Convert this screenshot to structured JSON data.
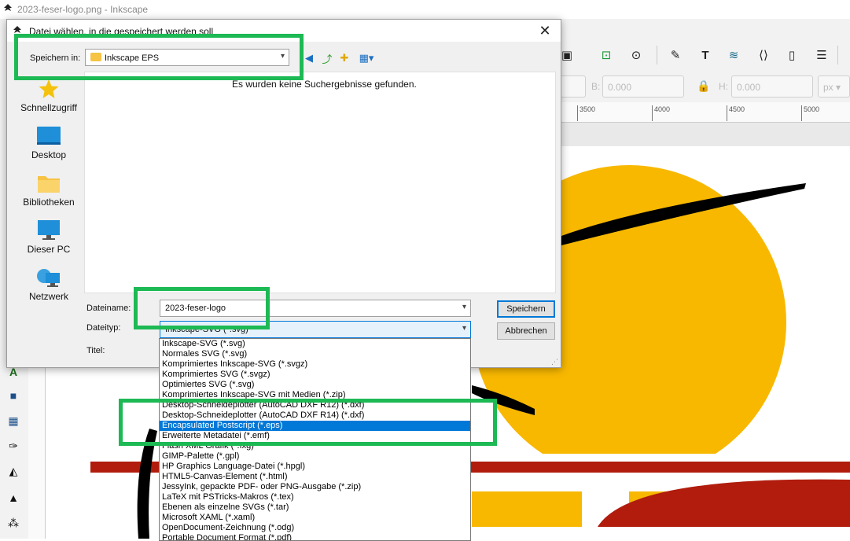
{
  "inkscape": {
    "window_title": "2023-feser-logo.png - Inkscape",
    "coords": {
      "b_label": "B:",
      "b_value": "0.000",
      "h_label": "H:",
      "h_value": "0.000",
      "unit": "px"
    },
    "ruler_ticks": [
      "3500",
      "4000",
      "4500",
      "5000"
    ],
    "colors": {
      "sun": "#f8b800",
      "stripe": "#b11c0c"
    }
  },
  "dialog": {
    "title": "Datei wählen, in die gespeichert werden soll",
    "save_in_label": "Speichern in:",
    "save_in_value": "Inkscape EPS",
    "empty_message": "Es wurden keine Suchergebnisse gefunden.",
    "places": [
      {
        "label": "Schnellzugriff",
        "icon": "star-icon"
      },
      {
        "label": "Desktop",
        "icon": "desktop-icon"
      },
      {
        "label": "Bibliotheken",
        "icon": "library-folder-icon"
      },
      {
        "label": "Dieser PC",
        "icon": "computer-icon"
      },
      {
        "label": "Netzwerk",
        "icon": "network-icon"
      }
    ],
    "filename_label": "Dateiname:",
    "filename_value": "2023-feser-logo",
    "filetype_label": "Dateityp:",
    "filetype_value": "Inkscape-SVG (*.svg)",
    "title_label": "Titel:",
    "save_button": "Speichern",
    "cancel_button": "Abbrechen",
    "filetype_options": [
      "Inkscape-SVG (*.svg)",
      "Normales SVG (*.svg)",
      "Komprimiertes Inkscape-SVG (*.svgz)",
      "Komprimiertes SVG (*.svgz)",
      "Optimiertes SVG (*.svg)",
      "Komprimiertes Inkscape-SVG mit Medien (*.zip)",
      "Desktop-Schneideplotter (AutoCAD DXF R12) (*.dxf)",
      "Desktop-Schneideplotter (AutoCAD DXF R14) (*.dxf)",
      "Encapsulated Postscript (*.eps)",
      "Erweiterte Metadatei (*.emf)",
      "Flash XML Grafik (*.fxg)",
      "GIMP-Palette (*.gpl)",
      "HP Graphics Language-Datei (*.hpgl)",
      "HTML5-Canvas-Element (*.html)",
      "JessyInk, gepackte PDF- oder PNG-Ausgabe (*.zip)",
      "LaTeX mit PSTricks-Makros (*.tex)",
      "Ebenen als einzelne SVGs (*.tar)",
      "Microsoft XAML (*.xaml)",
      "OpenDocument-Zeichnung (*.odg)",
      "Portable Document Format (*.pdf)"
    ],
    "selected_option": "Encapsulated Postscript (*.eps)"
  },
  "annotation_color": "#1db954"
}
